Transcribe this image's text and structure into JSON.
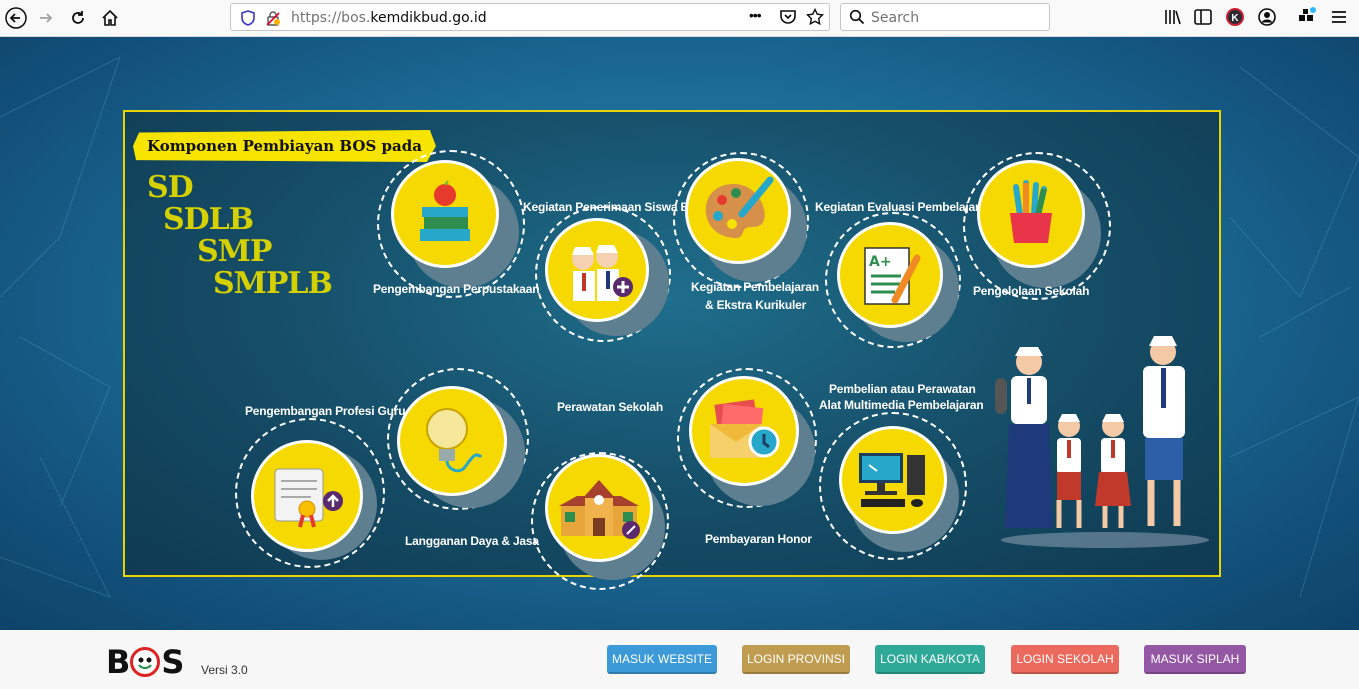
{
  "browser": {
    "url_prefix": "https://bos.",
    "url_domain": "kemdikbud.go.id",
    "search_placeholder": "Search",
    "more_label": "•••",
    "account_letter": "K"
  },
  "banner": {
    "title": "Komponen Pembiayan BOS pada",
    "levels": [
      "SD",
      "SDLB",
      "SMP",
      "SMPLB"
    ],
    "components": {
      "perpustakaan": "Pengembangan Perpustakaan",
      "penerimaan": "Kegiatan Penerimaan Siswa Baru",
      "pembelajaran_1": "Kegiatan Pembelajaran",
      "pembelajaran_2": "& Ekstra Kurikuler",
      "evaluasi": "Kegiatan Evaluasi Pembelajaran",
      "pengelolaan": "Pengelolaan Sekolah",
      "profesi": "Pengembangan Profesi Guru",
      "langganan": "Langganan Daya & Jasa",
      "perawatan": "Perawatan Sekolah",
      "honor": "Pembayaran Honor",
      "multimedia_1": "Pembelian atau Perawatan",
      "multimedia_2": "Alat Multimedia Pembelajaran"
    }
  },
  "footer": {
    "logo_b": "B",
    "logo_s": "S",
    "version": "Versi 3.0",
    "buttons": {
      "masuk_website": "MASUK WEBSITE",
      "login_provinsi": "LOGIN PROVINSI",
      "login_kabkota": "LOGIN KAB/KOTA",
      "login_sekolah": "LOGIN SEKOLAH",
      "masuk_siplah": "MASUK SIPLAH"
    }
  },
  "colors": {
    "btn_website": "#3d9ad9",
    "btn_provinsi": "#bf9c4f",
    "btn_kabkota": "#2ea998",
    "btn_sekolah": "#ec6a5d",
    "btn_siplah": "#9457a4",
    "banner_border": "#e8d400",
    "circle_fill": "#f5d900"
  }
}
